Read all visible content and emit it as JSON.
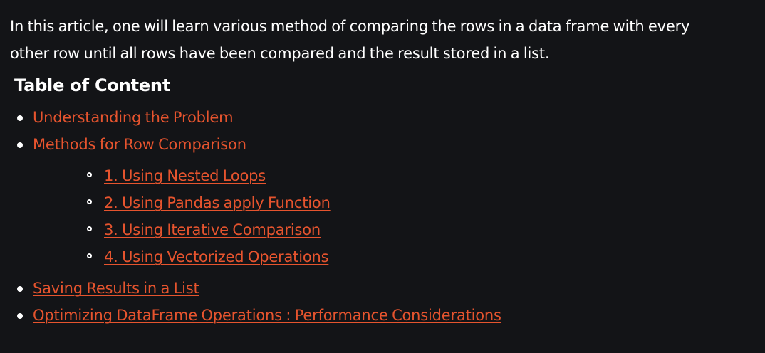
{
  "intro": {
    "line1": "In this article, one will learn various method of comparing the rows in a data frame with every",
    "line2": "other row until all rows have been compared and the result stored in a list."
  },
  "toc": {
    "title": "Table of Content",
    "items": [
      {
        "label": "Understanding the Problem"
      },
      {
        "label": "Methods for Row Comparison",
        "subitems": [
          "1. Using Nested Loops",
          "2. Using Pandas apply Function",
          "3. Using Iterative Comparison",
          "4. Using Vectorized Operations"
        ]
      },
      {
        "label": "Saving Results in a List"
      },
      {
        "label": "Optimizing DataFrame Operations : Performance Considerations"
      }
    ]
  },
  "colors": {
    "background": "#131417",
    "text": "#ffffff",
    "link": "#e6542e"
  },
  "icons": {
    "bullet": "filled-circle",
    "sub_bullet": "hollow-circle"
  }
}
